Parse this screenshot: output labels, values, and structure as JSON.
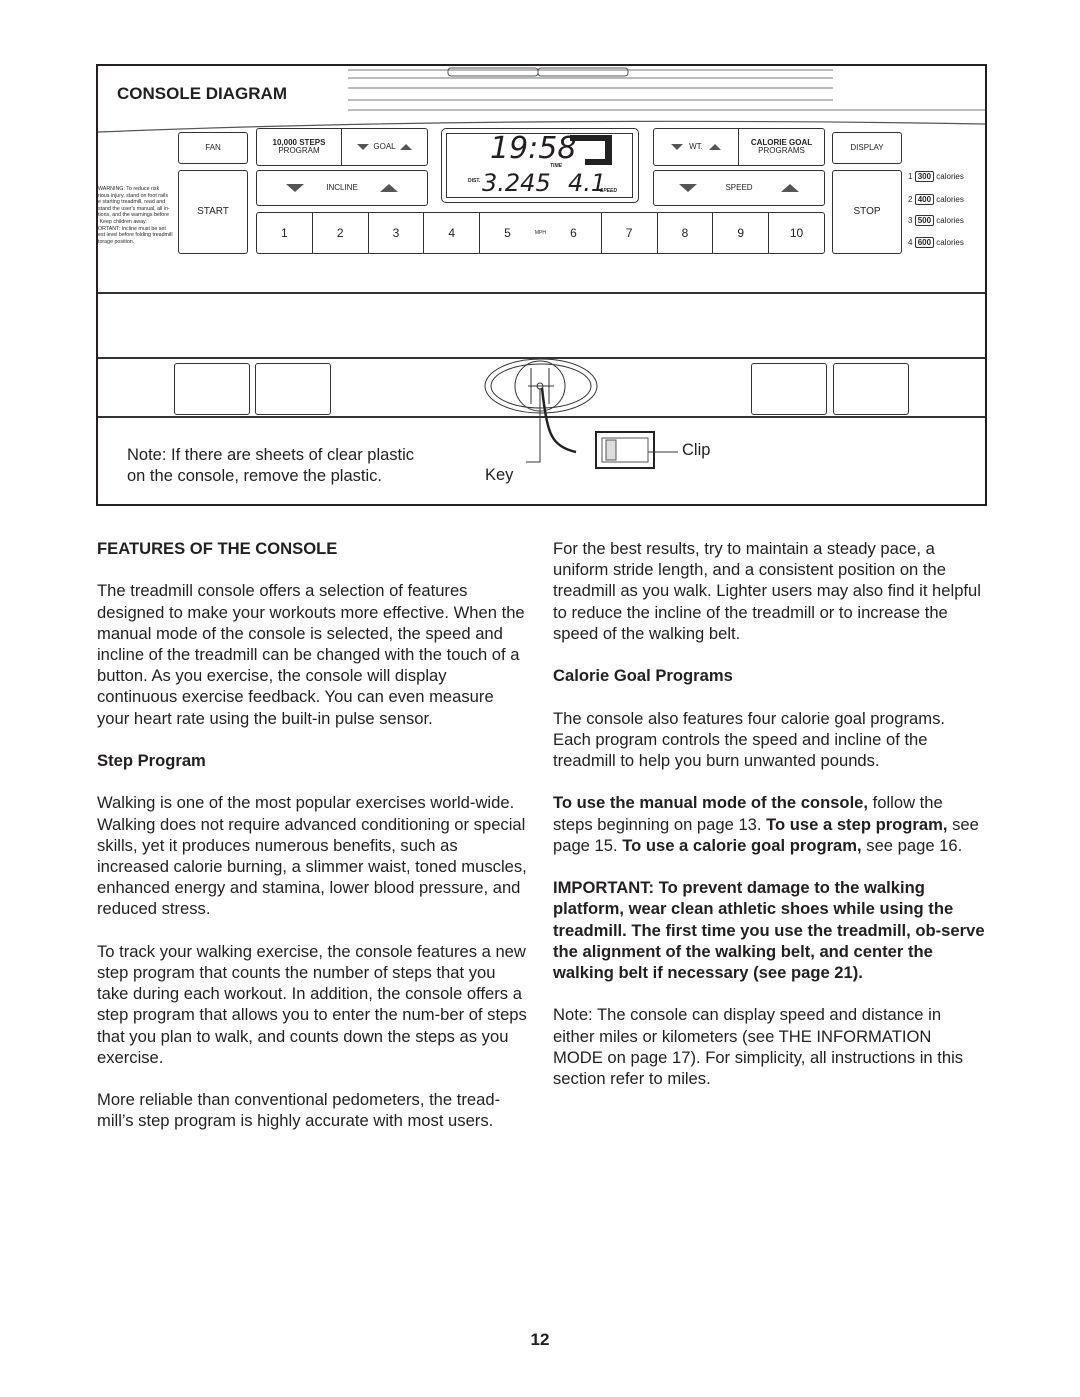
{
  "diagram": {
    "title": "CONSOLE DIAGRAM",
    "buttons": {
      "fan": "FAN",
      "steps_program": [
        "10,000 STEPS",
        "PROGRAM"
      ],
      "goal": "GOAL",
      "incline": "INCLINE",
      "start": "START",
      "wt": "WT.",
      "calorie_goal": [
        "CALORIE GOAL",
        "PROGRAMS"
      ],
      "display": "DISPLAY",
      "speed": "SPEED",
      "stop": "STOP",
      "numbers": [
        "1",
        "2",
        "3",
        "4",
        "5",
        "6",
        "7",
        "8",
        "9",
        "10"
      ],
      "mph": "MPH"
    },
    "lcd": {
      "time": "19:58",
      "time_label": "TIME",
      "dist_label": "DIST.",
      "distance": "3.245",
      "speed": "4.1",
      "speed_label": "SPEED"
    },
    "warning": "WARNING: To reduce risk\nrious injury, stand on foot rails\ne starting treadmill, read and\nstand the user's manual, all in-\ntions, and the warnings before\n Keep children away.\nORTANT: Incline must be set\nest level before folding treadmill\ntorage position.",
    "programs": [
      {
        "n": "1",
        "value": "300",
        "unit": "calories"
      },
      {
        "n": "2",
        "value": "400",
        "unit": "calories"
      },
      {
        "n": "3",
        "value": "500",
        "unit": "calories"
      },
      {
        "n": "4",
        "value": "600",
        "unit": "calories"
      }
    ],
    "note": [
      "Note: If there are sheets of clear plastic",
      "on the console, remove the plastic."
    ],
    "key_label": "Key",
    "clip_label": "Clip"
  },
  "left": {
    "heading": "FEATURES OF THE CONSOLE",
    "p1": "The treadmill console offers a selection of features designed to make your workouts more effective. When the manual mode of the console is selected, the speed and incline of the treadmill can be changed with the touch of a button. As you exercise, the console will display continuous exercise feedback. You can even measure your heart rate using the built-in pulse sensor.",
    "sub1": "Step Program",
    "p2": "Walking is one of the most popular exercises world-wide. Walking does not require advanced conditioning or special skills, yet it produces numerous benefits, such as increased calorie burning, a slimmer waist, toned muscles, enhanced energy and stamina, lower blood pressure, and reduced stress.",
    "p3": "To track your walking exercise, the console features a new step program that counts the number of steps that you take during each workout. In addition, the console offers a step program that allows you to enter the num-ber of steps that you plan to walk, and counts down the steps as you exercise.",
    "p4": "More reliable than conventional pedometers, the tread-mill’s step program is highly accurate with most users."
  },
  "right": {
    "p1": "For the best results, try to maintain a steady pace, a uniform stride length, and a consistent position on the treadmill as you walk. Lighter users may also find it helpful to reduce the incline of the treadmill or to increase the speed of the walking belt.",
    "sub1": "Calorie Goal Programs",
    "p2": "The console also features four calorie goal programs. Each program controls the speed and incline of the treadmill to help you burn unwanted pounds.",
    "p3": {
      "b1": "To use the manual mode of the console,",
      "t1": " follow the steps beginning on page 13. ",
      "b2": "To use a step program,",
      "t2": " see page 15. ",
      "b3": "To use a calorie goal program,",
      "t3": " see page 16."
    },
    "p4": "IMPORTANT: To prevent damage to the walking platform, wear clean athletic shoes while using the treadmill. The first time you use the treadmill, ob-serve the alignment of the walking belt, and center the walking belt if necessary (see page 21).",
    "p5": "Note: The console can display speed and distance in either miles or kilometers (see THE INFORMATION MODE on page 17). For simplicity, all instructions in this section refer to miles."
  },
  "page_number": "12"
}
